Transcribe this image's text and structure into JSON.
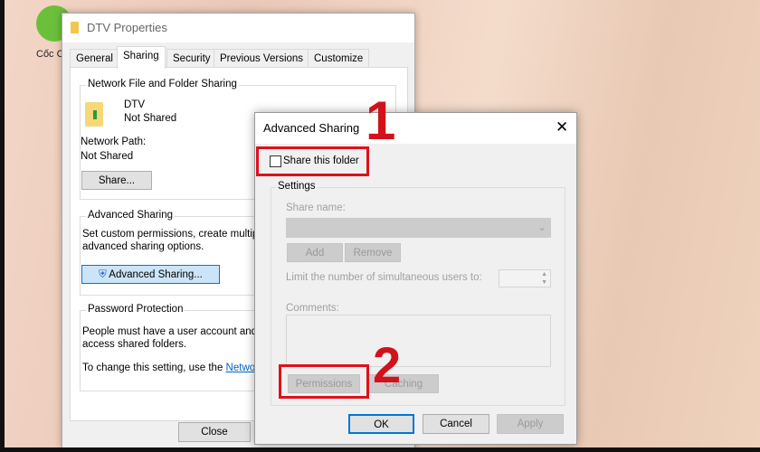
{
  "desktop": {
    "icon_label": "Cốc C"
  },
  "properties": {
    "title": "DTV Properties",
    "tabs": [
      "General",
      "Sharing",
      "Security",
      "Previous Versions",
      "Customize"
    ],
    "active_tab": "Sharing",
    "network_group": "Network File and Folder Sharing",
    "folder_name": "DTV",
    "folder_status": "Not Shared",
    "network_path_label": "Network Path:",
    "network_path_value": "Not Shared",
    "share_button": "Share...",
    "advanced_group": "Advanced Sharing",
    "advanced_desc1": "Set custom permissions, create multip",
    "advanced_desc2": "advanced sharing options.",
    "advanced_button": "Advanced Sharing...",
    "password_group": "Password Protection",
    "password_desc1": "People must have a user account and",
    "password_desc2": "access shared folders.",
    "password_change": "To change this setting, use the ",
    "password_link": "Networ",
    "close_button": "Close"
  },
  "advanced_dialog": {
    "title": "Advanced Sharing",
    "share_checkbox": "Share this folder",
    "share_checked": false,
    "settings_group": "Settings",
    "share_name_label": "Share name:",
    "share_name_value": "",
    "add_button": "Add",
    "remove_button": "Remove",
    "limit_label": "Limit the number of simultaneous users to:",
    "limit_value": "",
    "comments_label": "Comments:",
    "comments_value": "",
    "permissions_button": "Permissions",
    "caching_button": "Caching",
    "ok_button": "OK",
    "cancel_button": "Cancel",
    "apply_button": "Apply"
  },
  "annotations": {
    "step1": "1",
    "step2": "2",
    "color": "#e0101a"
  }
}
